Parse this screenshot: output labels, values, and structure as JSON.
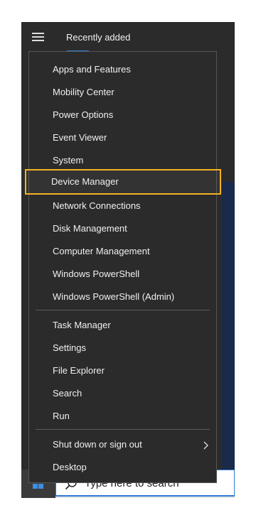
{
  "start": {
    "tab_label": "Recently added"
  },
  "taskbar": {
    "search_placeholder": "Type here to search"
  },
  "menu": {
    "group1": [
      "Apps and Features",
      "Mobility Center",
      "Power Options",
      "Event Viewer",
      "System",
      "Device Manager",
      "Network Connections",
      "Disk Management",
      "Computer Management",
      "Windows PowerShell",
      "Windows PowerShell (Admin)"
    ],
    "group2": [
      "Task Manager",
      "Settings",
      "File Explorer",
      "Search",
      "Run"
    ],
    "group3": [
      "Shut down or sign out",
      "Desktop"
    ],
    "highlighted": "Device Manager"
  },
  "colors": {
    "highlight_border": "#f4b222",
    "accent": "#2e7bd1",
    "menu_bg": "#2b2b2b"
  },
  "icons": {
    "hamburger": "hamburger-menu-icon",
    "windows_logo": "windows-logo-icon",
    "search": "search-icon",
    "submenu_arrow": "chevron-right-icon"
  }
}
